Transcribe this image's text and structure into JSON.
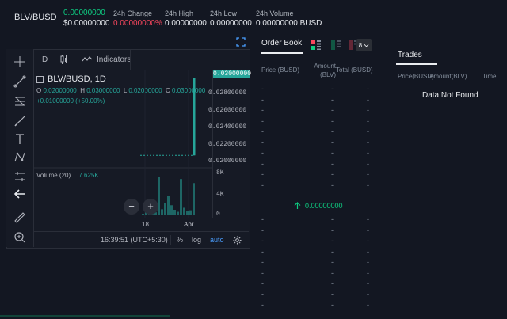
{
  "ticker": {
    "pair": "BLV/BUSD",
    "price": "0.00000000",
    "price_usd": "$0.00000000",
    "change_label": "24h Change",
    "change_value": "0.00000000%",
    "high_label": "24h High",
    "high_value": "0.00000000",
    "low_label": "24h Low",
    "low_value": "0.00000000",
    "volume_label": "24h Volume",
    "volume_value": "0.00000000 BUSD"
  },
  "chart": {
    "interval": "D",
    "indicators_label": "Indicators",
    "legend_title": "BLV/BUSD, 1D",
    "ohlc": {
      "o_label": "O",
      "o": "0.02000000",
      "h_label": "H",
      "h": "0.03000000",
      "l_label": "L",
      "l": "0.02000000",
      "c_label": "C",
      "c": "0.03000000"
    },
    "change": "+0.01000000 (+50.00%)",
    "price_ticks": [
      "0.02800000",
      "0.02600000",
      "0.02400000",
      "0.02200000",
      "0.02000000"
    ],
    "last_price": "0.03000000",
    "volume_label": "Volume (20)",
    "volume_value": "7.625K",
    "volume_ticks": [
      "8K",
      "4K",
      "0"
    ],
    "time_ticks": [
      "18",
      "Apr"
    ],
    "clock": "16:39:51 (UTC+5:30)",
    "percent_label": "%",
    "log_label": "log",
    "auto_label": "auto",
    "zoom_out": "−",
    "zoom_in": "+"
  },
  "chart_data": {
    "type": "bar",
    "candles": [
      {
        "open": 0.02,
        "high": 0.03,
        "low": 0.02,
        "close": 0.03
      }
    ],
    "volume_series": [
      0.3,
      0.9,
      0.5,
      1.4,
      0.6,
      7.625,
      1.2,
      2.4,
      3.8,
      2.0,
      1.1,
      0.7,
      7.2,
      1.5,
      0.8,
      1.0,
      6.4
    ],
    "ylim_price": [
      0.019,
      0.0305
    ],
    "ylim_volume": [
      0,
      8.8
    ]
  },
  "orderbook": {
    "title": "Order Book",
    "group_value": "8",
    "col_price": "Price (BUSD)",
    "col_amount": "Amount (BLV)",
    "col_total": "Total (BUSD)",
    "mid_price": "0.00000000",
    "placeholder": "-"
  },
  "trades": {
    "title": "Trades",
    "col_price": "Price(BUSD)",
    "col_amount": "Amount(BLV)",
    "col_time": "Time",
    "empty": "Data Not Found"
  },
  "colors": {
    "up": "#0ecb81",
    "down": "#f6465d",
    "bg": "#131722"
  }
}
